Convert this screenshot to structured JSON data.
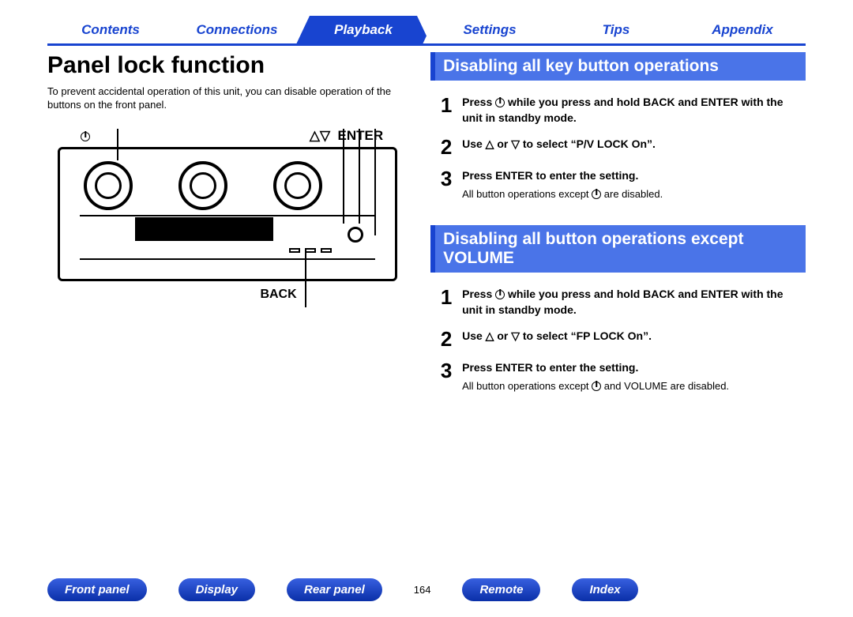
{
  "topnav": {
    "tabs": [
      "Contents",
      "Connections",
      "Playback",
      "Settings",
      "Tips",
      "Appendix"
    ],
    "active_index": 2
  },
  "page_title": "Panel lock function",
  "intro": "To prevent accidental operation of this unit, you can disable operation of the buttons on the front panel.",
  "diagram_labels": {
    "power": "⏻",
    "arrows": "△▽",
    "enter": "ENTER",
    "back": "BACK"
  },
  "section1": {
    "title": "Disabling all key button operations",
    "steps": [
      {
        "num": "1",
        "main_pre": "Press ",
        "main_post": " while you press and hold BACK and ENTER with the unit in standby mode.",
        "has_power_icon": true
      },
      {
        "num": "2",
        "main": "Use △ or ▽ to select “P/V LOCK On”."
      },
      {
        "num": "3",
        "main": "Press ENTER to enter the setting.",
        "sub_pre": "All button operations except ",
        "sub_post": " are disabled.",
        "has_power_icon_sub": true
      }
    ]
  },
  "section2": {
    "title": "Disabling all button operations except VOLUME",
    "steps": [
      {
        "num": "1",
        "main_pre": "Press ",
        "main_post": " while you press and hold BACK and ENTER with the unit in standby mode.",
        "has_power_icon": true
      },
      {
        "num": "2",
        "main": "Use △ or ▽ to select “FP LOCK On”."
      },
      {
        "num": "3",
        "main": "Press ENTER to enter the setting.",
        "sub_pre": "All button operations except ",
        "sub_post": " and VOLUME are disabled.",
        "has_power_icon_sub": true
      }
    ]
  },
  "bottomnav": {
    "pills": [
      "Front panel",
      "Display",
      "Rear panel"
    ],
    "page": "164",
    "pills2": [
      "Remote",
      "Index"
    ]
  }
}
